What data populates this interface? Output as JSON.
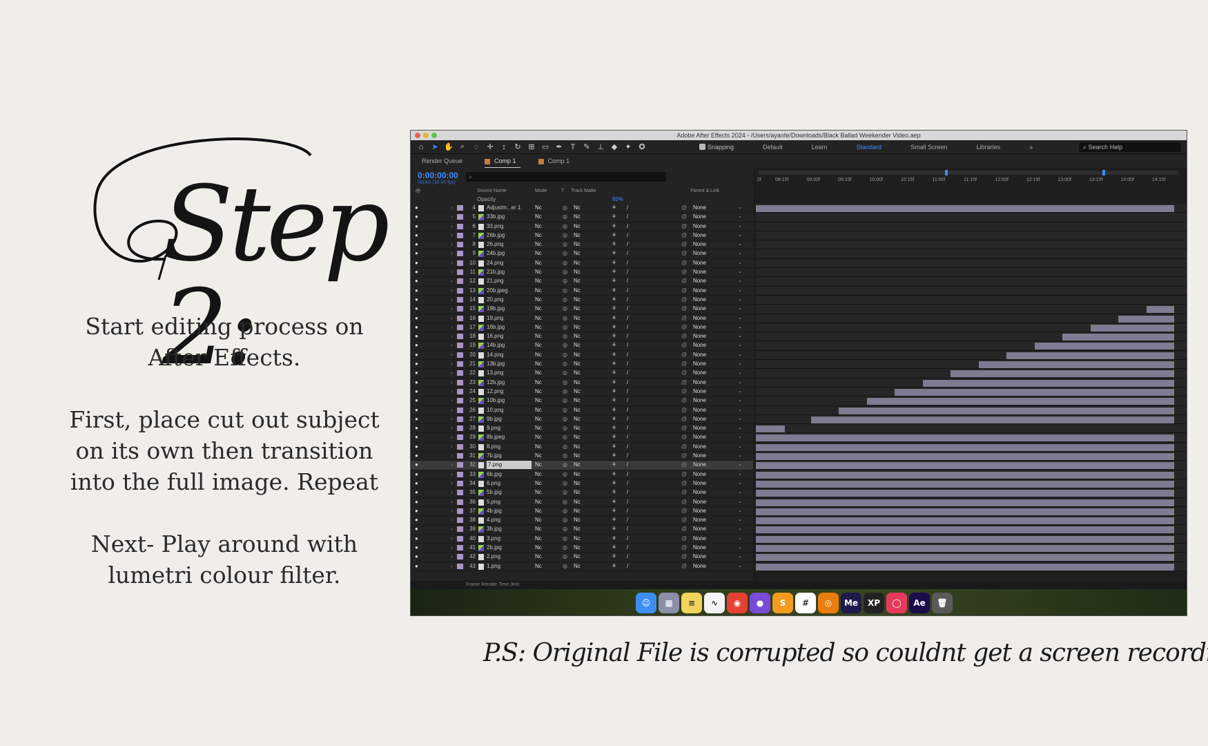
{
  "step": {
    "title": "Step 2:",
    "para1": "Start editing process on After Effects.",
    "para2": "First, place cut out subject on its own then transition into the full image. Repeat",
    "para3": "Next- Play around with lumetri colour filter.",
    "ps": "P.S: Original File is corrupted so couldnt get a screen recording :("
  },
  "window": {
    "title": "Adobe After Effects 2024 - /Users/ayanfe/Downloads/Black Ballad Weekender Video.aep"
  },
  "toolbar": {
    "snapping_label": "Snapping",
    "workspaces": [
      "Default",
      "Learn",
      "Standard",
      "Small Screen",
      "Libraries"
    ],
    "active_workspace": "Standard",
    "search_placeholder": "Search Help"
  },
  "tabs": {
    "render_queue": "Render Queue",
    "comp_active": "Comp 1",
    "comp_viewer": "Comp 1"
  },
  "timeline": {
    "timecode": "0:00:00:00",
    "fps": "00000 (30.00 fps)",
    "columns": {
      "source_name": "Source Name",
      "mode": "Mode",
      "t": "T",
      "track_matte": "Track Matte",
      "parent": "Parent & Link"
    },
    "opacity_label": "Opacity",
    "opacity_value": "60%",
    "ruler": [
      "0f",
      "08:15f",
      "09:00f",
      "09:15f",
      "10:00f",
      "10:15f",
      "11:00f",
      "11:15f",
      "12:00f",
      "12:15f",
      "13:00f",
      "13:15f",
      "14:00f",
      "14:15f"
    ],
    "mode_value": "Nc",
    "parent_value": "None",
    "frame_render_label": "Frame Render Time",
    "frame_render_value": "0ms"
  },
  "layers": [
    {
      "num": "4",
      "name": "Adjustm...er 1",
      "type": "adj"
    },
    {
      "num": "5",
      "name": "33b.jpg",
      "type": "jpg"
    },
    {
      "num": "6",
      "name": "33.png",
      "type": "png"
    },
    {
      "num": "7",
      "name": "26b.jpg",
      "type": "jpg"
    },
    {
      "num": "8",
      "name": "26.png",
      "type": "png"
    },
    {
      "num": "9",
      "name": "24b.jpg",
      "type": "jpg"
    },
    {
      "num": "10",
      "name": "24.png",
      "type": "png"
    },
    {
      "num": "11",
      "name": "21b.jpg",
      "type": "jpg"
    },
    {
      "num": "12",
      "name": "21.png",
      "type": "png"
    },
    {
      "num": "13",
      "name": "20b.jpeg",
      "type": "jpg"
    },
    {
      "num": "14",
      "name": "20.png",
      "type": "png"
    },
    {
      "num": "15",
      "name": "19b.jpg",
      "type": "jpg"
    },
    {
      "num": "16",
      "name": "19.png",
      "type": "png"
    },
    {
      "num": "17",
      "name": "16b.jpg",
      "type": "jpg"
    },
    {
      "num": "18",
      "name": "16.png",
      "type": "png"
    },
    {
      "num": "19",
      "name": "14b.jpg",
      "type": "jpg"
    },
    {
      "num": "20",
      "name": "14.png",
      "type": "png"
    },
    {
      "num": "21",
      "name": "13b.jpg",
      "type": "jpg"
    },
    {
      "num": "22",
      "name": "13.png",
      "type": "png"
    },
    {
      "num": "23",
      "name": "12b.jpg",
      "type": "jpg"
    },
    {
      "num": "24",
      "name": "12.png",
      "type": "png"
    },
    {
      "num": "25",
      "name": "10b.jpg",
      "type": "jpg"
    },
    {
      "num": "26",
      "name": "10.png",
      "type": "png"
    },
    {
      "num": "27",
      "name": "9b.jpg",
      "type": "jpg"
    },
    {
      "num": "28",
      "name": "9.png",
      "type": "png"
    },
    {
      "num": "29",
      "name": "8b.jpeg",
      "type": "jpg"
    },
    {
      "num": "30",
      "name": "8.png",
      "type": "png"
    },
    {
      "num": "31",
      "name": "7b.jpg",
      "type": "jpg"
    },
    {
      "num": "32",
      "name": "7.png",
      "type": "png",
      "selected": true
    },
    {
      "num": "33",
      "name": "6b.jpg",
      "type": "jpg"
    },
    {
      "num": "34",
      "name": "6.png",
      "type": "png"
    },
    {
      "num": "35",
      "name": "5b.jpg",
      "type": "jpg"
    },
    {
      "num": "36",
      "name": "5.png",
      "type": "png"
    },
    {
      "num": "37",
      "name": "4b.jpg",
      "type": "jpg"
    },
    {
      "num": "38",
      "name": "4.png",
      "type": "png"
    },
    {
      "num": "39",
      "name": "3b.jpg",
      "type": "jpg"
    },
    {
      "num": "40",
      "name": "3.png",
      "type": "png"
    },
    {
      "num": "41",
      "name": "2b.jpg",
      "type": "jpg"
    },
    {
      "num": "42",
      "name": "2.png",
      "type": "png"
    },
    {
      "num": "43",
      "name": "1.png",
      "type": "png"
    }
  ],
  "dock": [
    {
      "name": "finder-icon",
      "color": "#3c8ef0",
      "glyph": "☺"
    },
    {
      "name": "launchpad-icon",
      "color": "#8b8fa8",
      "glyph": "▦"
    },
    {
      "name": "notes-icon",
      "color": "#f2d35c",
      "glyph": "≡"
    },
    {
      "name": "freeform-icon",
      "color": "#f4f4f4",
      "glyph": "∿"
    },
    {
      "name": "chrome-icon",
      "color": "#e44134",
      "glyph": "◉"
    },
    {
      "name": "github-icon",
      "color": "#7a4bd6",
      "glyph": "●"
    },
    {
      "name": "sublime-icon",
      "color": "#f39a1f",
      "glyph": "S"
    },
    {
      "name": "slack-icon",
      "color": "#ffffff",
      "glyph": "#"
    },
    {
      "name": "blender-icon",
      "color": "#e87d0d",
      "glyph": "◎"
    },
    {
      "name": "media-encoder-icon",
      "color": "#1d1a4d",
      "glyph": "Me"
    },
    {
      "name": "xppen-icon",
      "color": "#222222",
      "glyph": "XP"
    },
    {
      "name": "creative-cloud-icon",
      "color": "#e63a5c",
      "glyph": "◯"
    },
    {
      "name": "after-effects-icon",
      "color": "#1a0b4b",
      "glyph": "Ae"
    },
    {
      "name": "trash-icon",
      "color": "#5a5a5a",
      "glyph": "🗑"
    }
  ]
}
